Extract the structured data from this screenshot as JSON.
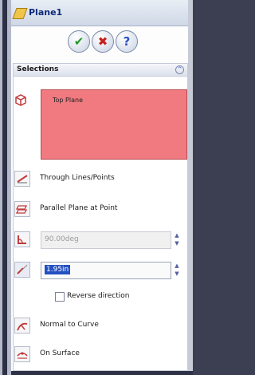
{
  "title": "Plane1",
  "buttons": {
    "ok": "✔",
    "cancel": "✖",
    "help": "?"
  },
  "section": {
    "title": "Selections",
    "collapse": "^"
  },
  "selection_list": {
    "items": [
      "Top Plane"
    ]
  },
  "options": [
    {
      "label": "Through Lines/Points"
    },
    {
      "label": "Parallel Plane at Point"
    }
  ],
  "angle": {
    "value": "90.00deg"
  },
  "distance": {
    "value": "1.95in"
  },
  "reverse_direction": {
    "label": "Reverse direction",
    "checked": false
  },
  "more_options": [
    {
      "label": "Normal to Curve"
    },
    {
      "label": "On Surface"
    }
  ],
  "colors": {
    "selection_box": "#f07a80",
    "accent": "#2451c2"
  }
}
